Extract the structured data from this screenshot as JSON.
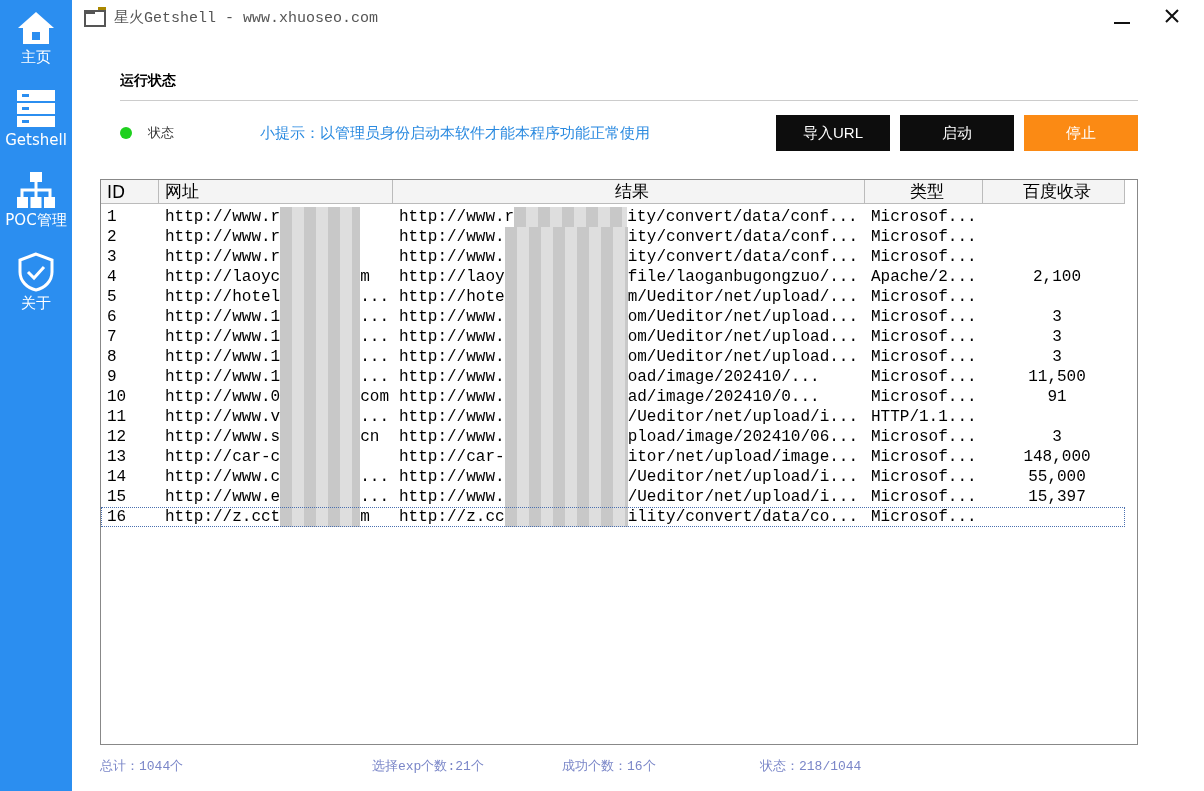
{
  "window": {
    "title": "星火Getshell - www.xhuoseo.com"
  },
  "sidebar": {
    "items": [
      {
        "label": "主页"
      },
      {
        "label": "Getshell"
      },
      {
        "label": "POC管理"
      },
      {
        "label": "关于"
      }
    ]
  },
  "section_title": "运行状态",
  "status_indicator": {
    "label": "状态",
    "on": true
  },
  "tip": "小提示：以管理员身份启动本软件才能本程序功能正常使用",
  "buttons": [
    {
      "label": "导入URL",
      "kind": "dark"
    },
    {
      "label": "启动",
      "kind": "dark"
    },
    {
      "label": "停止",
      "kind": "accent"
    }
  ],
  "table": {
    "columns": [
      "ID",
      "网址",
      "结果",
      "类型",
      "百度收录"
    ],
    "rows": [
      {
        "id": "1",
        "url": [
          "http://www.r"
        ],
        "result": [
          "http://www.r",
          "ity/convert/data/conf..."
        ],
        "type": "Microsof...",
        "selected": false
      },
      {
        "id": "2",
        "url": [
          "http://www.r"
        ],
        "result": [
          "http://www.",
          "ity/convert/data/conf..."
        ],
        "type": "Microsof...",
        "selected": false
      },
      {
        "id": "3",
        "url": [
          "http://www.r"
        ],
        "result": [
          "http://www.",
          "ity/convert/data/conf..."
        ],
        "type": "Microsof...",
        "selected": false
      },
      {
        "id": "4",
        "url": [
          "http://laoyc",
          "m"
        ],
        "result": [
          "http://laoy",
          "file/laoganbugongzuo/..."
        ],
        "type": "Apache/2...",
        "baidu": "2,100",
        "selected": false
      },
      {
        "id": "5",
        "url": [
          "http://hotel",
          "..."
        ],
        "result": [
          "http://hote",
          "m/Ueditor/net/upload/..."
        ],
        "type": "Microsof...",
        "selected": false
      },
      {
        "id": "6",
        "url": [
          "http://www.1",
          "..."
        ],
        "result": [
          "http://www.",
          "om/Ueditor/net/upload..."
        ],
        "type": "Microsof...",
        "baidu": "3",
        "selected": false
      },
      {
        "id": "7",
        "url": [
          "http://www.1",
          "..."
        ],
        "result": [
          "http://www.",
          "om/Ueditor/net/upload..."
        ],
        "type": "Microsof...",
        "baidu": "3",
        "selected": false
      },
      {
        "id": "8",
        "url": [
          "http://www.1",
          "..."
        ],
        "result": [
          "http://www.",
          "om/Ueditor/net/upload..."
        ],
        "type": "Microsof...",
        "baidu": "3",
        "selected": false
      },
      {
        "id": "9",
        "url": [
          "http://www.1",
          "..."
        ],
        "result": [
          "http://www.",
          "oad/image/202410/..."
        ],
        "type": "Microsof...",
        "baidu": "11,500",
        "selected": false
      },
      {
        "id": "10",
        "url": [
          "http://www.0",
          "com"
        ],
        "result": [
          "http://www.",
          "ad/image/202410/0..."
        ],
        "type": "Microsof...",
        "baidu": "91",
        "selected": false
      },
      {
        "id": "11",
        "url": [
          "http://www.v",
          "..."
        ],
        "result": [
          "http://www.",
          "/Ueditor/net/upload/i..."
        ],
        "type": "HTTP/1.1...",
        "selected": false
      },
      {
        "id": "12",
        "url": [
          "http://www.s",
          "cn"
        ],
        "result": [
          "http://www.",
          "pload/image/202410/06..."
        ],
        "type": "Microsof...",
        "baidu": "3",
        "selected": false
      },
      {
        "id": "13",
        "url": [
          "http://car-c"
        ],
        "result": [
          "http://car-",
          "itor/net/upload/image..."
        ],
        "type": "Microsof...",
        "baidu": "148,000",
        "selected": false
      },
      {
        "id": "14",
        "url": [
          "http://www.c",
          "..."
        ],
        "result": [
          "http://www.",
          "/Ueditor/net/upload/i..."
        ],
        "type": "Microsof...",
        "baidu": "55,000",
        "selected": false
      },
      {
        "id": "15",
        "url": [
          "http://www.e",
          "..."
        ],
        "result": [
          "http://www.",
          "/Ueditor/net/upload/i..."
        ],
        "type": "Microsof...",
        "baidu": "15,397",
        "selected": false
      },
      {
        "id": "16",
        "url": [
          "http://z.cct",
          "m"
        ],
        "result": [
          "http://z.cc",
          "ility/convert/data/co..."
        ],
        "type": "Microsof...",
        "selected": true
      }
    ]
  },
  "status_bar": [
    "总计：1044个",
    "选择exp个数:21个",
    "成功个数：16个",
    "状态：218/1044"
  ]
}
